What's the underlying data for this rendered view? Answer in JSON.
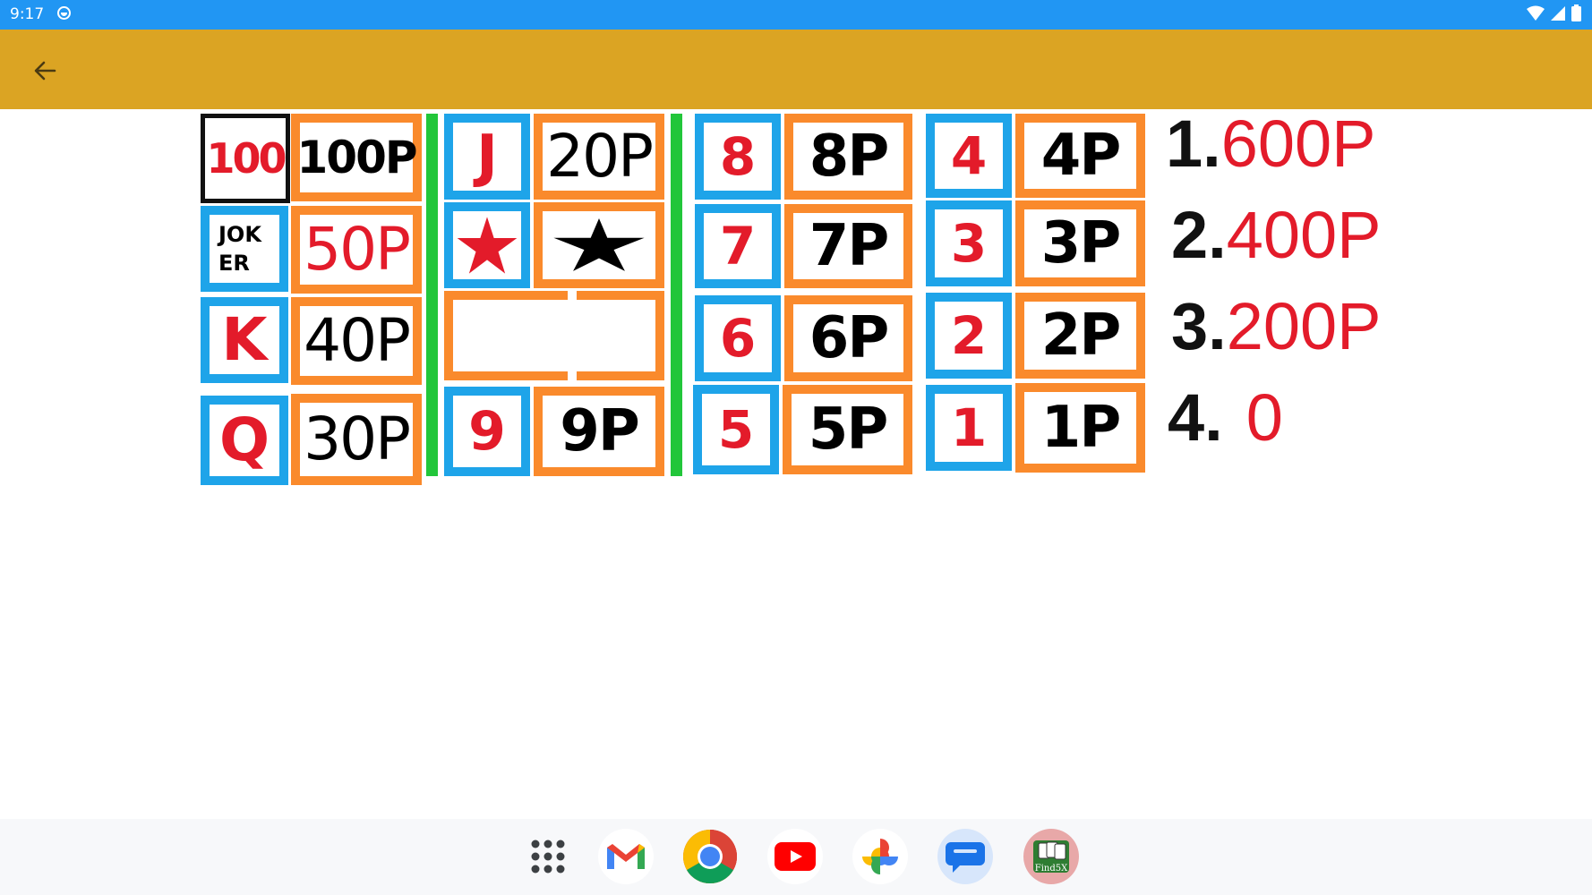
{
  "status_bar": {
    "time": "9:17"
  },
  "board": {
    "left": [
      {
        "symbol": "100",
        "value": "100P"
      },
      {
        "symbol_lines": [
          "JOK",
          "ER"
        ],
        "value": "50P"
      },
      {
        "symbol": "K",
        "value": "40P"
      },
      {
        "symbol": "Q",
        "value": "30P"
      }
    ],
    "middle": [
      {
        "symbol": "J",
        "value": "20P"
      },
      {
        "symbol": "star-icon",
        "value": "star-icon"
      },
      {
        "symbol": "",
        "value": ""
      },
      {
        "symbol": "9",
        "value": "9P"
      }
    ],
    "right_a": [
      {
        "symbol": "8",
        "value": "8P"
      },
      {
        "symbol": "7",
        "value": "7P"
      },
      {
        "symbol": "6",
        "value": "6P"
      },
      {
        "symbol": "5",
        "value": "5P"
      }
    ],
    "right_b": [
      {
        "symbol": "4",
        "value": "4P"
      },
      {
        "symbol": "3",
        "value": "3P"
      },
      {
        "symbol": "2",
        "value": "2P"
      },
      {
        "symbol": "1",
        "value": "1P"
      }
    ]
  },
  "ranking": [
    {
      "place": "1.",
      "points": "600P"
    },
    {
      "place": "2.",
      "points": "400P"
    },
    {
      "place": "3.",
      "points": "200P"
    },
    {
      "place": "4.",
      "points": "0"
    }
  ],
  "colors": {
    "blue": "#1ea4e9",
    "orange": "#fa8a2c",
    "green": "#22c63a",
    "red": "#e31b2a",
    "app_bar": "#dba423",
    "status_bar": "#2196f3"
  },
  "dock": [
    {
      "name": "app-drawer-icon"
    },
    {
      "name": "gmail-icon"
    },
    {
      "name": "chrome-icon"
    },
    {
      "name": "youtube-icon"
    },
    {
      "name": "photos-icon"
    },
    {
      "name": "messages-icon"
    },
    {
      "name": "find5x-app-icon",
      "label": "Find5X"
    }
  ]
}
